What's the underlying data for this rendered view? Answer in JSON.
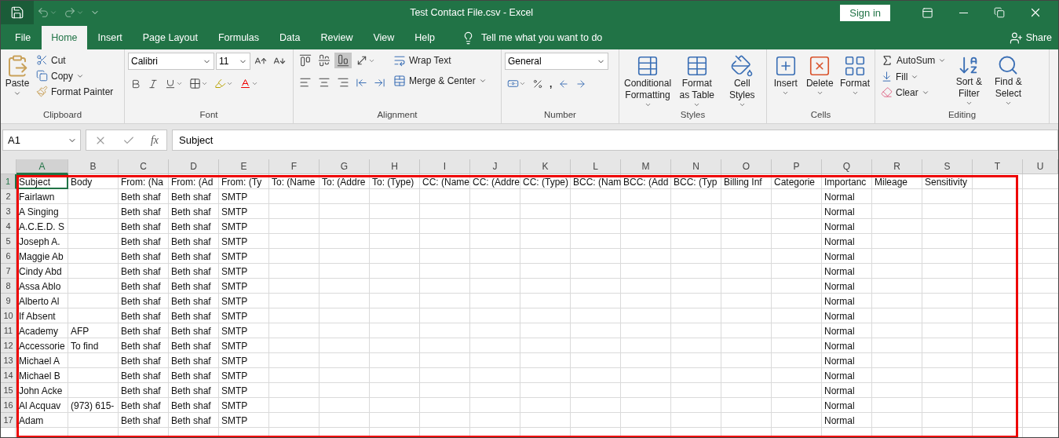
{
  "title_bar": {
    "title": "Test Contact File.csv  -  Excel",
    "sign_in": "Sign in"
  },
  "menu_tabs": [
    {
      "label": "File",
      "selected": false
    },
    {
      "label": "Home",
      "selected": true
    },
    {
      "label": "Insert",
      "selected": false
    },
    {
      "label": "Page Layout",
      "selected": false
    },
    {
      "label": "Formulas",
      "selected": false
    },
    {
      "label": "Data",
      "selected": false
    },
    {
      "label": "Review",
      "selected": false
    },
    {
      "label": "View",
      "selected": false
    },
    {
      "label": "Help",
      "selected": false
    }
  ],
  "tell_me": "Tell me what you want to do",
  "share": "Share",
  "ribbon": {
    "clipboard": {
      "label": "Clipboard",
      "paste": "Paste",
      "cut": "Cut",
      "copy": "Copy",
      "format_painter": "Format Painter"
    },
    "font": {
      "label": "Font",
      "name": "Calibri",
      "size": "11"
    },
    "alignment": {
      "label": "Alignment",
      "wrap": "Wrap Text",
      "merge": "Merge & Center"
    },
    "number": {
      "label": "Number",
      "format": "General",
      "comma": ","
    },
    "styles": {
      "label": "Styles",
      "items": [
        "Conditional Formatting",
        "Format as Table",
        "Cell Styles"
      ]
    },
    "cells": {
      "label": "Cells",
      "items": [
        "Insert",
        "Delete",
        "Format"
      ]
    },
    "editing": {
      "label": "Editing",
      "autosum": "AutoSum",
      "fill": "Fill",
      "clear": "Clear",
      "sort": "Sort & Filter",
      "find": "Find & Select"
    }
  },
  "formula_bar": {
    "name_box": "A1",
    "function_label": "fx",
    "value": "Subject"
  },
  "sheet": {
    "columns": [
      {
        "letter": "A",
        "selected": true
      },
      {
        "letter": "B",
        "selected": false
      },
      {
        "letter": "C",
        "selected": false
      },
      {
        "letter": "D",
        "selected": false
      },
      {
        "letter": "E",
        "selected": false
      },
      {
        "letter": "F",
        "selected": false
      },
      {
        "letter": "G",
        "selected": false
      },
      {
        "letter": "H",
        "selected": false
      },
      {
        "letter": "I",
        "selected": false
      },
      {
        "letter": "J",
        "selected": false
      },
      {
        "letter": "K",
        "selected": false
      },
      {
        "letter": "L",
        "selected": false
      },
      {
        "letter": "M",
        "selected": false
      },
      {
        "letter": "N",
        "selected": false
      },
      {
        "letter": "O",
        "selected": false
      },
      {
        "letter": "P",
        "selected": false
      },
      {
        "letter": "Q",
        "selected": false
      },
      {
        "letter": "R",
        "selected": false
      },
      {
        "letter": "S",
        "selected": false
      },
      {
        "letter": "T",
        "selected": false
      },
      {
        "letter": "U",
        "selected": false
      }
    ],
    "rows": [
      {
        "number": "1",
        "selected": true,
        "cells": [
          "Subject",
          "Body",
          "From: (Na",
          "From: (Ad",
          "From: (Ty",
          "To: (Name",
          "To: (Addre",
          "To: (Type)",
          "CC: (Name",
          "CC: (Addre",
          "CC: (Type)",
          "BCC: (Nam",
          "BCC: (Add",
          "BCC: (Typ",
          "Billing Inf",
          "Categorie",
          "Importanc",
          "Mileage",
          "Sensitivity",
          null
        ]
      },
      {
        "number": "2",
        "selected": false,
        "cells": [
          "Fairlawn",
          null,
          "Beth shaf",
          "Beth shaf",
          "SMTP",
          null,
          null,
          null,
          null,
          null,
          null,
          null,
          null,
          null,
          null,
          null,
          "Normal",
          null,
          null,
          null
        ]
      },
      {
        "number": "3",
        "selected": false,
        "cells": [
          "A Singing",
          null,
          "Beth shaf",
          "Beth shaf",
          "SMTP",
          null,
          null,
          null,
          null,
          null,
          null,
          null,
          null,
          null,
          null,
          null,
          "Normal",
          null,
          null,
          null
        ]
      },
      {
        "number": "4",
        "selected": false,
        "cells": [
          "A.C.E.D. S",
          null,
          "Beth shaf",
          "Beth shaf",
          "SMTP",
          null,
          null,
          null,
          null,
          null,
          null,
          null,
          null,
          null,
          null,
          null,
          "Normal",
          null,
          null,
          null
        ]
      },
      {
        "number": "5",
        "selected": false,
        "cells": [
          "Joseph A.",
          null,
          "Beth shaf",
          "Beth shaf",
          "SMTP",
          null,
          null,
          null,
          null,
          null,
          null,
          null,
          null,
          null,
          null,
          null,
          "Normal",
          null,
          null,
          null
        ]
      },
      {
        "number": "6",
        "selected": false,
        "cells": [
          "Maggie Ab",
          null,
          "Beth shaf",
          "Beth shaf",
          "SMTP",
          null,
          null,
          null,
          null,
          null,
          null,
          null,
          null,
          null,
          null,
          null,
          "Normal",
          null,
          null,
          null
        ]
      },
      {
        "number": "7",
        "selected": false,
        "cells": [
          "Cindy Abd",
          null,
          "Beth shaf",
          "Beth shaf",
          "SMTP",
          null,
          null,
          null,
          null,
          null,
          null,
          null,
          null,
          null,
          null,
          null,
          "Normal",
          null,
          null,
          null
        ]
      },
      {
        "number": "8",
        "selected": false,
        "cells": [
          "Assa Ablo",
          null,
          "Beth shaf",
          "Beth shaf",
          "SMTP",
          null,
          null,
          null,
          null,
          null,
          null,
          null,
          null,
          null,
          null,
          null,
          "Normal",
          null,
          null,
          null
        ]
      },
      {
        "number": "9",
        "selected": false,
        "cells": [
          "Alberto Al",
          null,
          "Beth shaf",
          "Beth shaf",
          "SMTP",
          null,
          null,
          null,
          null,
          null,
          null,
          null,
          null,
          null,
          null,
          null,
          "Normal",
          null,
          null,
          null
        ]
      },
      {
        "number": "10",
        "selected": false,
        "cells": [
          "If Absent",
          null,
          "Beth shaf",
          "Beth shaf",
          "SMTP",
          null,
          null,
          null,
          null,
          null,
          null,
          null,
          null,
          null,
          null,
          null,
          "Normal",
          null,
          null,
          null
        ]
      },
      {
        "number": "11",
        "selected": false,
        "cells": [
          "Academy",
          "AFP",
          "Beth shaf",
          "Beth shaf",
          "SMTP",
          null,
          null,
          null,
          null,
          null,
          null,
          null,
          null,
          null,
          null,
          null,
          "Normal",
          null,
          null,
          null
        ]
      },
      {
        "number": "12",
        "selected": false,
        "cells": [
          "Accessorie",
          "To find",
          "Beth shaf",
          "Beth shaf",
          "SMTP",
          null,
          null,
          null,
          null,
          null,
          null,
          null,
          null,
          null,
          null,
          null,
          "Normal",
          null,
          null,
          null
        ]
      },
      {
        "number": "13",
        "selected": false,
        "cells": [
          "Michael A",
          null,
          "Beth shaf",
          "Beth shaf",
          "SMTP",
          null,
          null,
          null,
          null,
          null,
          null,
          null,
          null,
          null,
          null,
          null,
          "Normal",
          null,
          null,
          null
        ]
      },
      {
        "number": "14",
        "selected": false,
        "cells": [
          "Michael B",
          null,
          "Beth shaf",
          "Beth shaf",
          "SMTP",
          null,
          null,
          null,
          null,
          null,
          null,
          null,
          null,
          null,
          null,
          null,
          "Normal",
          null,
          null,
          null
        ]
      },
      {
        "number": "15",
        "selected": false,
        "cells": [
          "John Acke",
          null,
          "Beth shaf",
          "Beth shaf",
          "SMTP",
          null,
          null,
          null,
          null,
          null,
          null,
          null,
          null,
          null,
          null,
          null,
          "Normal",
          null,
          null,
          null
        ]
      },
      {
        "number": "16",
        "selected": false,
        "cells": [
          "Al Acquav",
          "(973) 615-",
          "Beth shaf",
          "Beth shaf",
          "SMTP",
          null,
          null,
          null,
          null,
          null,
          null,
          null,
          null,
          null,
          null,
          null,
          "Normal",
          null,
          null,
          null
        ]
      },
      {
        "number": "17",
        "selected": false,
        "cells": [
          "Adam",
          null,
          "Beth shaf",
          "Beth shaf",
          "SMTP",
          null,
          null,
          null,
          null,
          null,
          null,
          null,
          null,
          null,
          null,
          null,
          "Normal",
          null,
          null,
          null
        ]
      }
    ]
  }
}
